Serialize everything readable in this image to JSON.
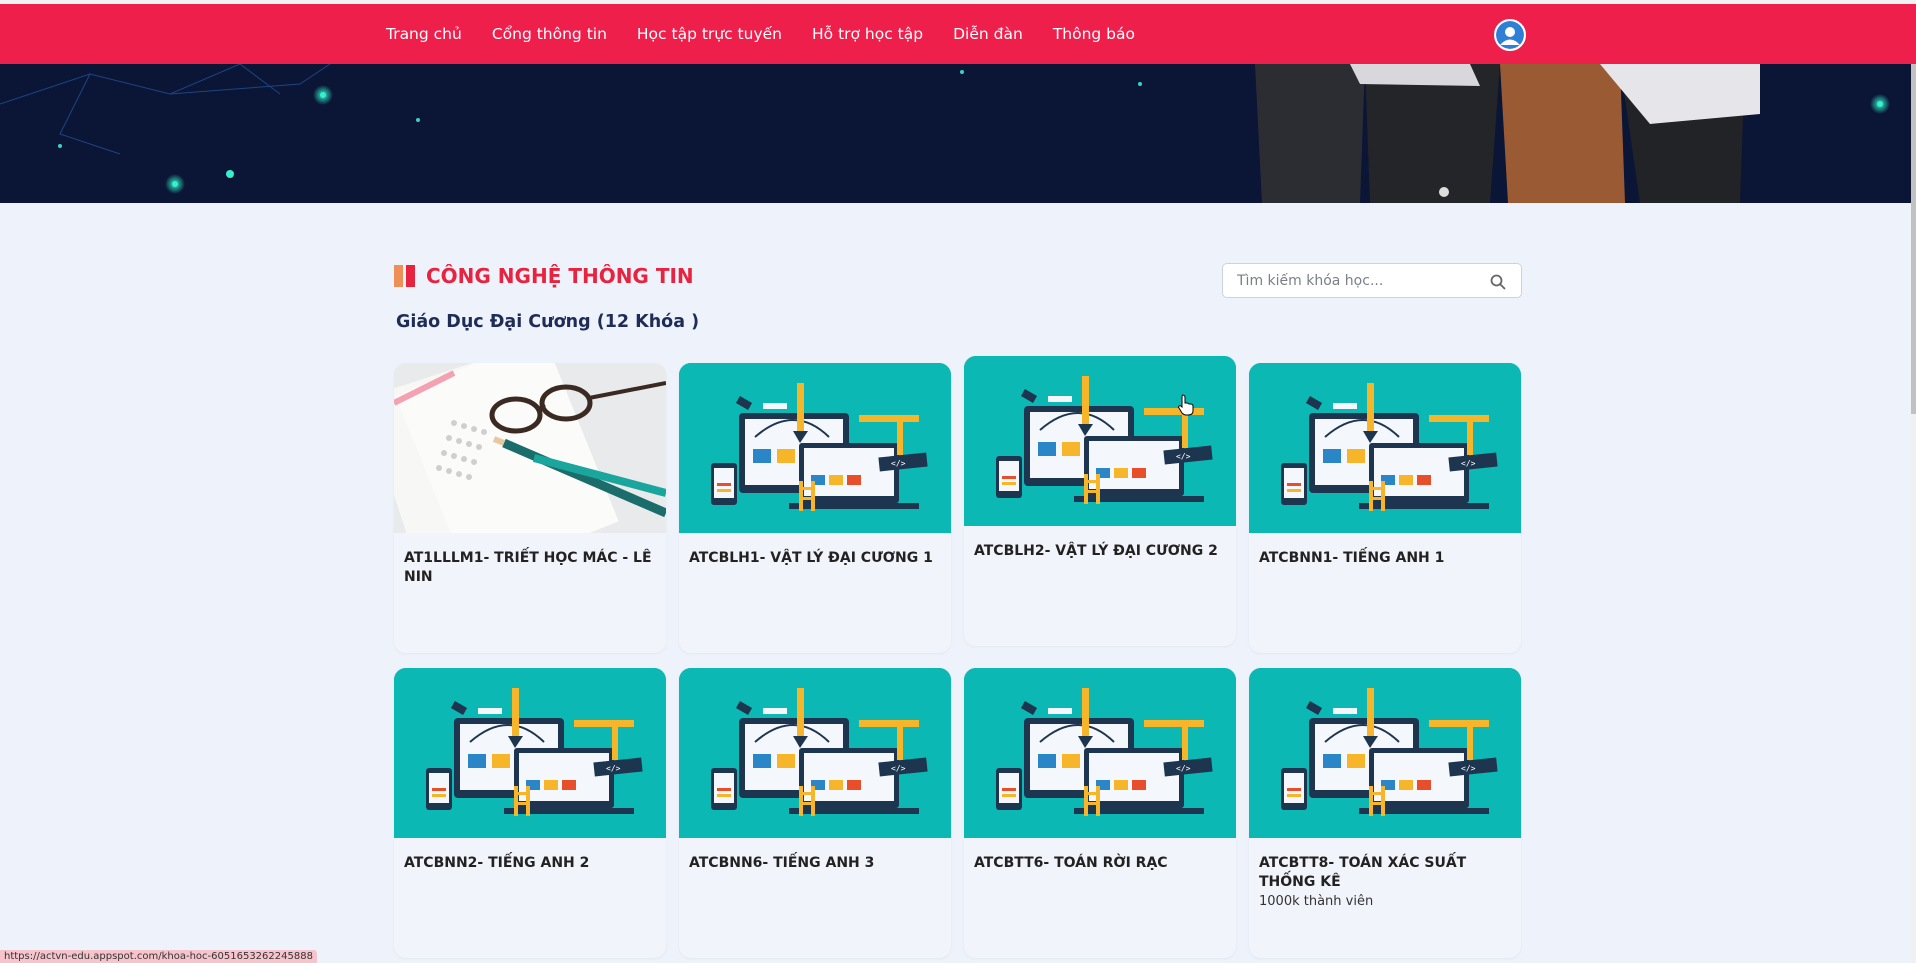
{
  "nav": {
    "items": [
      "Trang chủ",
      "Cổng thông tin",
      "Học tập trực tuyến",
      "Hỗ trợ học tập",
      "Diễn đàn",
      "Thông báo"
    ],
    "avatar_icon": "user-avatar-icon",
    "color": "#ef1f4c"
  },
  "section": {
    "title": "CÔNG NGHỆ THÔNG TIN",
    "subtitle": "Giáo Dục Đại Cương (12 Khóa )",
    "title_color": "#e8233f"
  },
  "search": {
    "placeholder": "Tìm kiếm khóa học...",
    "icon": "search-icon"
  },
  "courses": [
    {
      "title": "AT1LLLM1- TRIẾT HỌC MÁC - LÊ NIN",
      "image": "exam-sheet-photo",
      "meta": ""
    },
    {
      "title": "ATCBLH1- VẬT LÝ ĐẠI CƯƠNG 1",
      "image": "web-design-illustration",
      "meta": ""
    },
    {
      "title": "ATCBLH2- VẬT LÝ ĐẠI CƯƠNG 2",
      "image": "web-design-illustration",
      "meta": ""
    },
    {
      "title": "ATCBNN1- TIẾNG ANH 1",
      "image": "web-design-illustration",
      "meta": ""
    },
    {
      "title": "ATCBNN2- TIẾNG ANH 2",
      "image": "web-design-illustration",
      "meta": ""
    },
    {
      "title": "ATCBNN6- TIẾNG ANH 3",
      "image": "web-design-illustration",
      "meta": ""
    },
    {
      "title": "ATCBTT6- TOÁN RỜI RẠC",
      "image": "web-design-illustration",
      "meta": ""
    },
    {
      "title": "ATCBTT8- TOÁN XÁC SUẤT THỐNG KÊ",
      "image": "web-design-illustration",
      "meta": "1000k thành viên"
    }
  ],
  "status_url": "https://actvn-edu.appspot.com/khoa-hoc-6051653262245888"
}
